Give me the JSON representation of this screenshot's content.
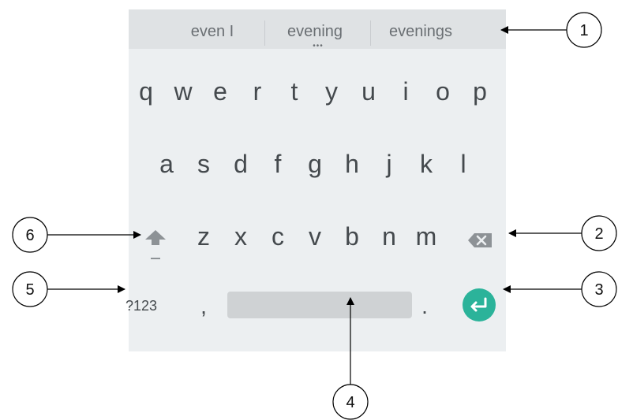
{
  "suggestions": [
    "even I",
    "evening",
    "evenings"
  ],
  "keyboard": {
    "row1": [
      "q",
      "w",
      "e",
      "r",
      "t",
      "y",
      "u",
      "i",
      "o",
      "p"
    ],
    "row2": [
      "a",
      "s",
      "d",
      "f",
      "g",
      "h",
      "j",
      "k",
      "l"
    ],
    "row3": [
      "z",
      "x",
      "c",
      "v",
      "b",
      "n",
      "m"
    ],
    "symbols_label": "?123",
    "comma": ",",
    "period": "."
  },
  "icons": {
    "shift": "shift-arrow-icon",
    "backspace": "backspace-icon",
    "enter": "enter-return-icon",
    "more": "more-suggestions-dots-icon"
  },
  "colors": {
    "keyboard_bg": "#eceff1",
    "suggestion_bar_bg": "#dfe2e4",
    "key_text": "#44494d",
    "enter_key": "#2bb39a",
    "space_bar": "#cfd2d4"
  },
  "callouts": [
    {
      "number": "1",
      "target": "suggestion-bar"
    },
    {
      "number": "2",
      "target": "backspace-key"
    },
    {
      "number": "3",
      "target": "enter-key"
    },
    {
      "number": "4",
      "target": "space-key"
    },
    {
      "number": "5",
      "target": "sym-key"
    },
    {
      "number": "6",
      "target": "shift-key"
    }
  ]
}
